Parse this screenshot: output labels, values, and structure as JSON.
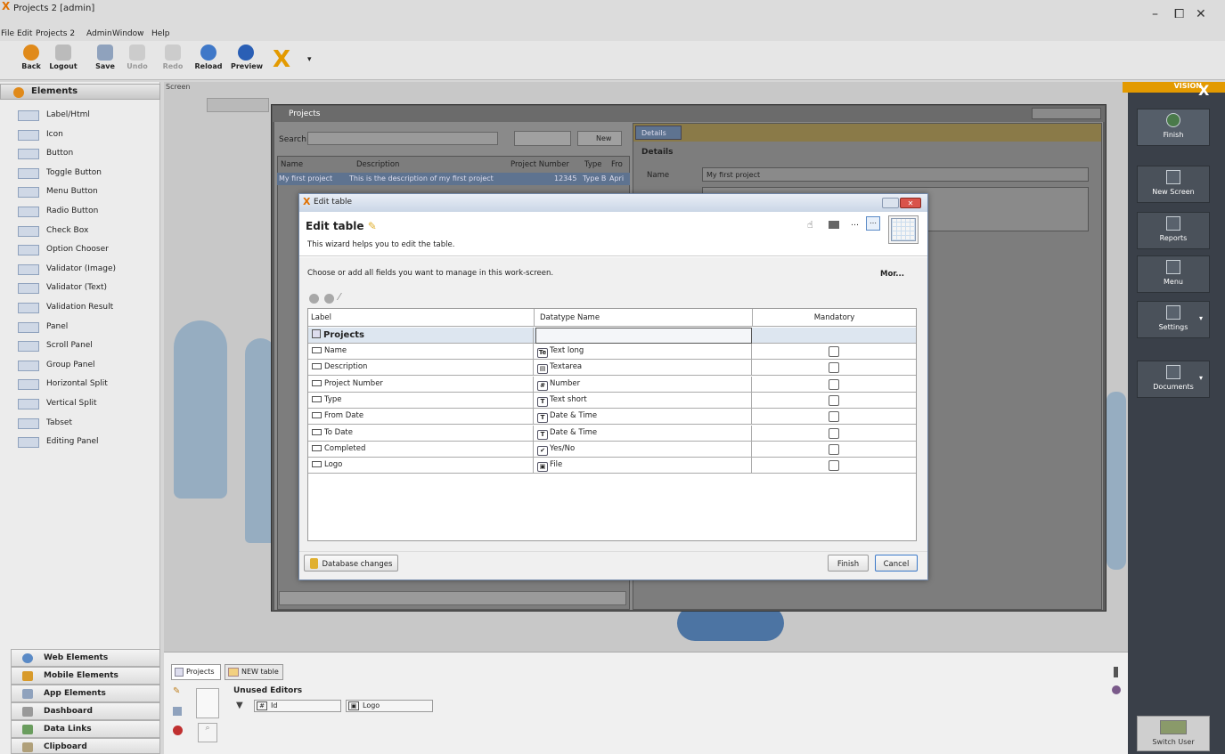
{
  "window": {
    "title": "Projects 2 [admin]",
    "minimize": "–",
    "maximize": "⧠",
    "close": "✕"
  },
  "menu": [
    "File",
    "Edit",
    "Projects 2",
    "Admin",
    "Window",
    "Help"
  ],
  "toolbar": {
    "back": "Back",
    "logout": "Logout",
    "save": "Save",
    "undo": "Undo",
    "redo": "Redo",
    "reload": "Reload",
    "preview": "Preview"
  },
  "left": {
    "header": "Elements",
    "items": [
      "Label/Html",
      "Icon",
      "Button",
      "Toggle Button",
      "Menu Button",
      "Radio Button",
      "Check Box",
      "Option Chooser",
      "Validator (Image)",
      "Validator (Text)",
      "Validation Result",
      "Panel",
      "Scroll Panel",
      "Group Panel",
      "Horizontal Split",
      "Vertical Split",
      "Tabset",
      "Editing Panel"
    ],
    "categories": [
      "Web Elements",
      "Mobile Elements",
      "App Elements",
      "Dashboard",
      "Data Links",
      "Clipboard"
    ]
  },
  "canvas": {
    "screen_label": "Screen"
  },
  "projects": {
    "title": "Projects",
    "search_label": "Search",
    "new_button": "New",
    "columns": [
      "Name",
      "Description",
      "Project Number",
      "Type",
      "Fro"
    ],
    "row": [
      "My first project",
      "This is the description of my first project",
      "12345",
      "Type B",
      "Apri"
    ],
    "details_tab": "Details",
    "details_header": "Details",
    "name_label": "Name",
    "name_value": "My first project"
  },
  "dialog": {
    "title": "Edit table",
    "heading": "Edit table",
    "subtitle": "This wizard helps you to edit the table.",
    "instruction": "Choose or add all fields you want to manage in this work-screen.",
    "more": "Mor...",
    "columns": {
      "label": "Label",
      "datatype": "Datatype Name",
      "mandatory": "Mandatory"
    },
    "table_name": "Projects",
    "rows": [
      {
        "label": "Name",
        "type": "Text long",
        "icon": "Te"
      },
      {
        "label": "Description",
        "type": "Textarea",
        "icon": "▤"
      },
      {
        "label": "Project Number",
        "type": "Number",
        "icon": "#"
      },
      {
        "label": "Type",
        "type": "Text short",
        "icon": "T"
      },
      {
        "label": "From Date",
        "type": "Date & Time",
        "icon": "T"
      },
      {
        "label": "To Date",
        "type": "Date & Time",
        "icon": "T"
      },
      {
        "label": "Completed",
        "type": "Yes/No",
        "icon": "✔"
      },
      {
        "label": "Logo",
        "type": "File",
        "icon": "▣"
      }
    ],
    "db_changes": "Database changes",
    "finish": "Finish",
    "cancel": "Cancel"
  },
  "right": {
    "vision": "VISION",
    "finish": "Finish",
    "new_screen": "New Screen",
    "reports": "Reports",
    "menu": "Menu",
    "settings": "Settings",
    "documents": "Documents",
    "switch_user": "Switch User"
  },
  "bottom": {
    "tab_projects": "Projects",
    "tab_new_table": "NEW table",
    "unused_editors": "Unused Editors",
    "editor_id": "Id",
    "editor_logo": "Logo"
  }
}
